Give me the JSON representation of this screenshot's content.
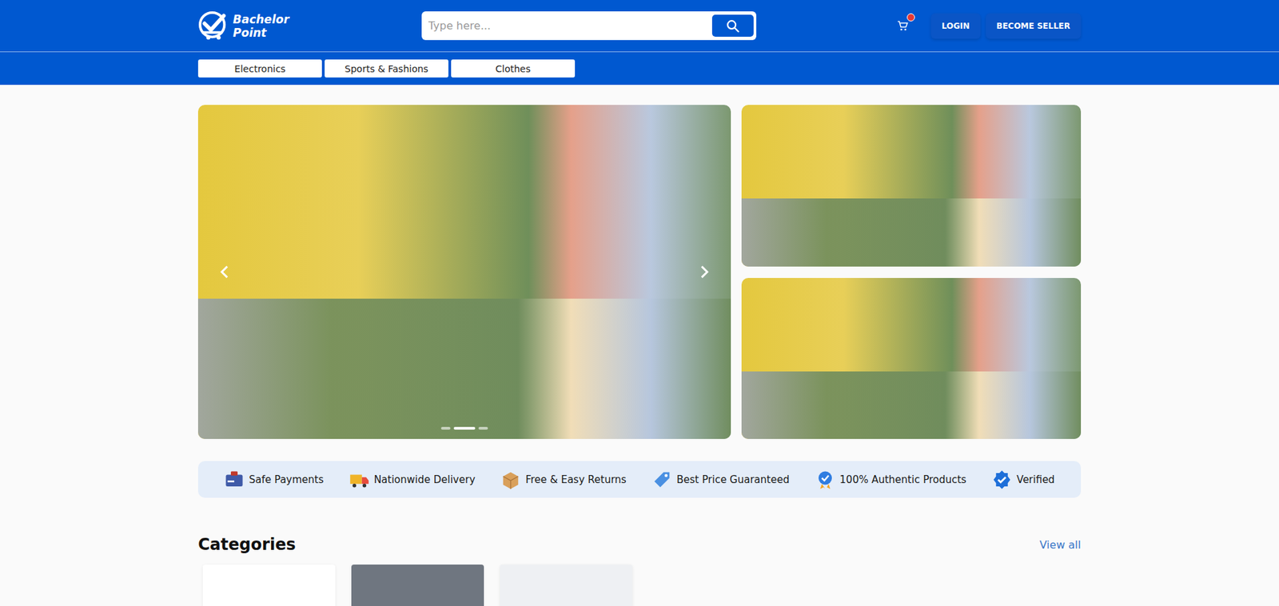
{
  "logo": {
    "line1": "Bachelor",
    "line2": "Point"
  },
  "search": {
    "placeholder": "Type here..."
  },
  "cart": {
    "has_items": true
  },
  "header_buttons": [
    "LOGIN",
    "BECOME SELLER"
  ],
  "nav": [
    "Electronics",
    "Sports & Fashions",
    "Clothes"
  ],
  "carousel": {
    "dots": [
      {
        "selected": false
      },
      {
        "selected": true
      },
      {
        "selected": false
      }
    ]
  },
  "side_banners": 2,
  "features": [
    {
      "label": "Safe Payments",
      "color": "#3f5aa8"
    },
    {
      "label": "Nationwide Delivery",
      "color": "#f0b429"
    },
    {
      "label": "Free & Easy Returns",
      "color": "#d9a05b"
    },
    {
      "label": "Best Price Guaranteed",
      "color": "#4a90e2"
    },
    {
      "label": "100% Authentic Products",
      "color": "#2f7de1"
    },
    {
      "label": "Verified",
      "color": "#1e6fd9"
    }
  ],
  "categories": {
    "title": "Categories",
    "view_all": "View all",
    "cards": [
      {
        "color": "#ffffff"
      },
      {
        "color": "#6f7680"
      },
      {
        "color": "#eef0f3"
      }
    ]
  }
}
